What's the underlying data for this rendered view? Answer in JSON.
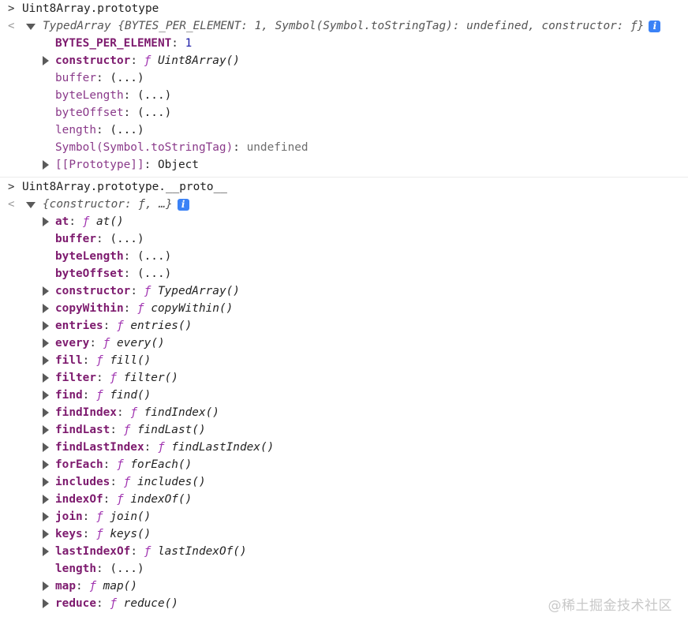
{
  "console": {
    "entries": [
      {
        "input": "Uint8Array.prototype",
        "summary": {
          "class": "TypedArray",
          "text": "{BYTES_PER_ELEMENT: 1, Symbol(Symbol.toStringTag): undefined, constructor: ƒ}"
        },
        "properties": [
          {
            "key": "BYTES_PER_ELEMENT",
            "kind": "number",
            "value": "1",
            "expandable": false,
            "own": true
          },
          {
            "key": "constructor",
            "kind": "function",
            "value": "Uint8Array()",
            "expandable": true,
            "own": true
          },
          {
            "key": "buffer",
            "kind": "getter",
            "value": "(...)",
            "expandable": false,
            "own": false
          },
          {
            "key": "byteLength",
            "kind": "getter",
            "value": "(...)",
            "expandable": false,
            "own": false
          },
          {
            "key": "byteOffset",
            "kind": "getter",
            "value": "(...)",
            "expandable": false,
            "own": false
          },
          {
            "key": "length",
            "kind": "getter",
            "value": "(...)",
            "expandable": false,
            "own": false
          },
          {
            "key": "Symbol(Symbol.toStringTag)",
            "kind": "undefined",
            "value": "undefined",
            "expandable": false,
            "own": false
          },
          {
            "key": "[[Prototype]]",
            "kind": "object",
            "value": "Object",
            "expandable": true,
            "own": false
          }
        ]
      },
      {
        "input": "Uint8Array.prototype.__proto__",
        "summary": {
          "class": "",
          "text": "{constructor: ƒ, …}"
        },
        "properties": [
          {
            "key": "at",
            "kind": "function",
            "value": "at()",
            "expandable": true,
            "own": true
          },
          {
            "key": "buffer",
            "kind": "getter",
            "value": "(...)",
            "expandable": false,
            "own": true
          },
          {
            "key": "byteLength",
            "kind": "getter",
            "value": "(...)",
            "expandable": false,
            "own": true
          },
          {
            "key": "byteOffset",
            "kind": "getter",
            "value": "(...)",
            "expandable": false,
            "own": true
          },
          {
            "key": "constructor",
            "kind": "function",
            "value": "TypedArray()",
            "expandable": true,
            "own": true
          },
          {
            "key": "copyWithin",
            "kind": "function",
            "value": "copyWithin()",
            "expandable": true,
            "own": true
          },
          {
            "key": "entries",
            "kind": "function",
            "value": "entries()",
            "expandable": true,
            "own": true
          },
          {
            "key": "every",
            "kind": "function",
            "value": "every()",
            "expandable": true,
            "own": true
          },
          {
            "key": "fill",
            "kind": "function",
            "value": "fill()",
            "expandable": true,
            "own": true
          },
          {
            "key": "filter",
            "kind": "function",
            "value": "filter()",
            "expandable": true,
            "own": true
          },
          {
            "key": "find",
            "kind": "function",
            "value": "find()",
            "expandable": true,
            "own": true
          },
          {
            "key": "findIndex",
            "kind": "function",
            "value": "findIndex()",
            "expandable": true,
            "own": true
          },
          {
            "key": "findLast",
            "kind": "function",
            "value": "findLast()",
            "expandable": true,
            "own": true
          },
          {
            "key": "findLastIndex",
            "kind": "function",
            "value": "findLastIndex()",
            "expandable": true,
            "own": true
          },
          {
            "key": "forEach",
            "kind": "function",
            "value": "forEach()",
            "expandable": true,
            "own": true
          },
          {
            "key": "includes",
            "kind": "function",
            "value": "includes()",
            "expandable": true,
            "own": true
          },
          {
            "key": "indexOf",
            "kind": "function",
            "value": "indexOf()",
            "expandable": true,
            "own": true
          },
          {
            "key": "join",
            "kind": "function",
            "value": "join()",
            "expandable": true,
            "own": true
          },
          {
            "key": "keys",
            "kind": "function",
            "value": "keys()",
            "expandable": true,
            "own": true
          },
          {
            "key": "lastIndexOf",
            "kind": "function",
            "value": "lastIndexOf()",
            "expandable": true,
            "own": true
          },
          {
            "key": "length",
            "kind": "getter",
            "value": "(...)",
            "expandable": false,
            "own": true
          },
          {
            "key": "map",
            "kind": "function",
            "value": "map()",
            "expandable": true,
            "own": true
          },
          {
            "key": "reduce",
            "kind": "function",
            "value": "reduce()",
            "expandable": true,
            "own": true
          }
        ]
      }
    ],
    "function_glyph": "ƒ",
    "info_badge": "i",
    "colors": {
      "key": "#7d1a6e",
      "number": "#1a1aa6",
      "function_glyph": "#a033b0",
      "info_badge": "#3b82f6"
    }
  },
  "watermark": "@稀土掘金技术社区"
}
